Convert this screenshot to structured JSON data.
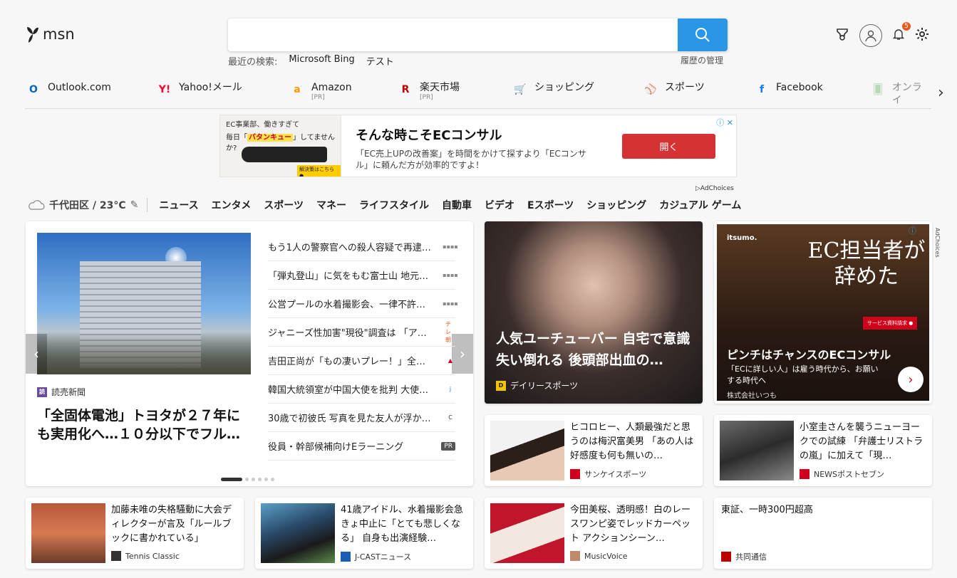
{
  "brand": {
    "name": "msn"
  },
  "search": {
    "placeholder": "",
    "recent_label": "最近の検索:",
    "recent": [
      "Microsoft Bing",
      "テスト"
    ],
    "history": "履歴の管理"
  },
  "header": {
    "notifications": "5"
  },
  "links": [
    {
      "label": "Outlook.com",
      "pr": "",
      "color": "#0a64c2",
      "glyph": "O"
    },
    {
      "label": "Yahoo!メール",
      "pr": "",
      "color": "#ff0033",
      "glyph": "Y!"
    },
    {
      "label": "Amazon",
      "pr": "[PR]",
      "color": "#ff9900",
      "glyph": "a"
    },
    {
      "label": "楽天市場",
      "pr": "[PR]",
      "color": "#bf0000",
      "glyph": "R"
    },
    {
      "label": "ショッピング",
      "pr": "",
      "color": "#1a73e8",
      "glyph": "🛒"
    },
    {
      "label": "スポーツ",
      "pr": "",
      "color": "#24406b",
      "glyph": "⚾"
    },
    {
      "label": "Facebook",
      "pr": "",
      "color": "#1877f2",
      "glyph": "f"
    },
    {
      "label": "オンライ",
      "pr": "",
      "color": "#7cb87c",
      "glyph": "🂠"
    }
  ],
  "banner": {
    "img_line1": "EC事業部、働きすぎて",
    "img_line2_pre": "毎日「",
    "img_highlight": "バタンキュー",
    "img_line2_post": "」してませんか?",
    "img_cta": "解決策はこちら ●",
    "title": "そんな時こそECコンサル",
    "desc": "「EC売上UPの改善案」を時間をかけて探すより「ECコンサル」に頼んだ方が効率的ですよ！",
    "button": "開く",
    "adchoices": "AdChoices"
  },
  "nav": {
    "weather": "千代田区 / 23°C",
    "items": [
      "ニュース",
      "エンタメ",
      "スポーツ",
      "マネー",
      "ライフスタイル",
      "自動車",
      "ビデオ",
      "Eスポーツ",
      "ショッピング",
      "カジュアル ゲーム"
    ]
  },
  "hero": {
    "source": "読売新聞",
    "title": "「全固体電池」トヨタが２７年にも実用化へ…１０分以下でフル…",
    "list": [
      {
        "text": "もう1人の警察官への殺人容疑で再逮…",
        "src": "▪▪▪▪",
        "srccolor": "#888"
      },
      {
        "text": "「弾丸登山」に気をもむ富士山 地元…",
        "src": "▪▪▪▪",
        "srccolor": "#888"
      },
      {
        "text": "公営プールの水着撮影会、一律不許…",
        "src": "▪▪▪▪",
        "srccolor": "#888"
      },
      {
        "text": "ジャニーズ性加害\"現役\"調査は 「ア…",
        "src": "テレ朝",
        "srccolor": "#e8591b"
      },
      {
        "text": "吉田正尚が「もの凄いプレー！」全…",
        "src": "▲",
        "srccolor": "#d0021b"
      },
      {
        "text": "韓国大統領室が中国大使を批判 大使…",
        "src": "j",
        "srccolor": "#1a73e8"
      },
      {
        "text": "30歳で初彼氏 写真を見た友人が浮か…",
        "src": "C",
        "srccolor": "#333"
      },
      {
        "text": "役員・幹部候補向けEラーニング",
        "src": "PR",
        "srccolor": "#555"
      }
    ]
  },
  "featured": {
    "title": "人気ユーチューバー 自宅で意識失い倒れる 後頭部出血の…",
    "source": "デイリースポーツ"
  },
  "ad2": {
    "logo": "itsumo.",
    "headline": "EC担当者が辞めた",
    "button": "サービス資料請求 ●",
    "title": "ピンチはチャンスのECコンサル",
    "desc": "「ECに詳しい人」は雇う時代から、お願いする時代へ",
    "company": "株式会社いつも",
    "adchoices": "AdChoices"
  },
  "cards": [
    {
      "title": "ヒコロヒー、人類最強だと思うのは梅沢富美男 「あの人は好感度も何も無いの…",
      "source": "サンケイスポーツ",
      "srccolor": "#d0021b"
    },
    {
      "title": "小室圭さんを襲うニューヨークでの試練 「弁護士リストラの嵐」に加えて「現…",
      "source": "NEWSポストセブン",
      "srccolor": "#d0021b"
    },
    {
      "title": "加藤未唯の失格騒動に大会ディレクターが言及「ルールブックに書かれている」",
      "source": "Tennis Classic",
      "srccolor": "#333"
    },
    {
      "title": "41歳アイドル、水着撮影会急きょ中止に「とても悲しくなる」 自身も出演経験…",
      "source": "J-CASTニュース",
      "srccolor": "#1a5fb4"
    },
    {
      "title": "今田美桜、透明感！白のレースワンピ姿でレッドカーペット アクションシーン…",
      "source": "MusicVoice",
      "srccolor": "#c08a6a"
    },
    {
      "title": "東証、一時300円超高",
      "source": "共同通信",
      "srccolor": "#b00"
    }
  ]
}
